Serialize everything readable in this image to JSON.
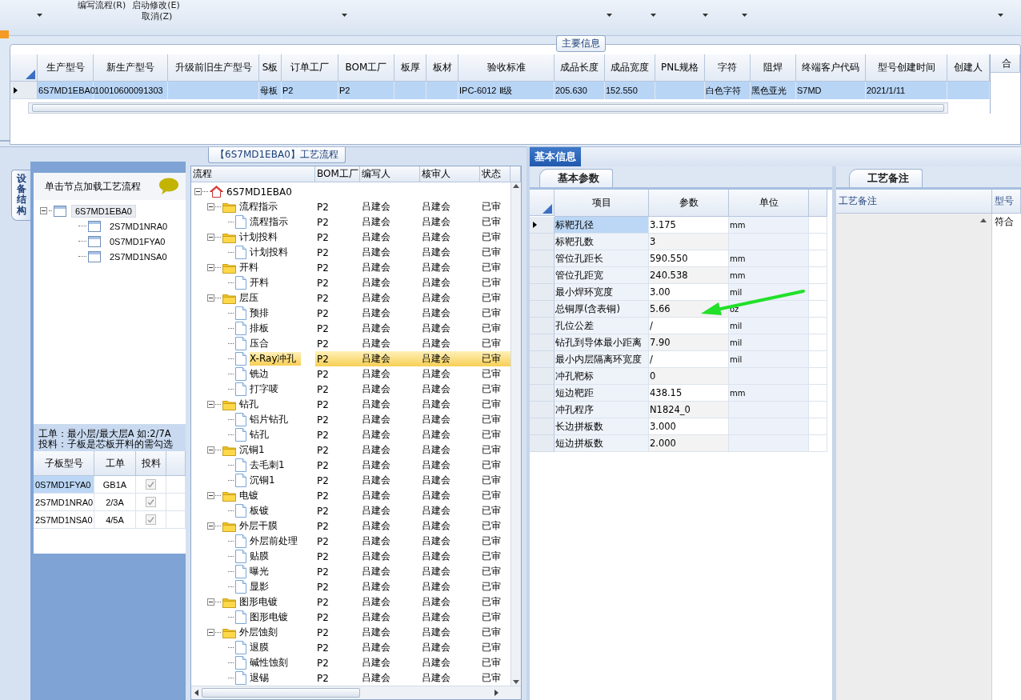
{
  "ribbon": {
    "buttons": [
      {
        "label": "编写流程(R)"
      },
      {
        "label": "启动修改(E)"
      },
      {
        "label": "取消(Z)"
      }
    ]
  },
  "main_info": {
    "title": "主要信息",
    "columns": [
      "生产型号",
      "新生产型号",
      "升级前旧生产型号",
      "S板",
      "订单工厂",
      "BOM工厂",
      "板厚",
      "板材",
      "验收标准",
      "成品长度",
      "成品宽度",
      "PNL规格",
      "字符",
      "阻焊",
      "终端客户代码",
      "型号创建时间",
      "创建人"
    ],
    "rows": [
      {
        "selected": true,
        "cells": [
          "6S7MD1EBA0",
          "10010600091303",
          null,
          "母板",
          "P2",
          "P2",
          null,
          null,
          "IPC-6012 Ⅱ级",
          "205.630",
          "152.550",
          null,
          "白色字符",
          "黑色亚光",
          "S7MD",
          "2021/1/11",
          null
        ]
      }
    ],
    "side_column": "合"
  },
  "structure_tab": {
    "label": "设备结构",
    "selected": true
  },
  "board_tree": {
    "hint": "单击节点加载工艺流程",
    "nodes": [
      {
        "label": "6S7MD1EBA0",
        "selected": true,
        "expanded": true,
        "children": [
          {
            "label": "2S7MD1NRA0",
            "selected": false
          },
          {
            "label": "0S7MD1FYA0",
            "selected": false
          },
          {
            "label": "2S7MD1NSA0",
            "selected": false
          }
        ]
      }
    ]
  },
  "sub_boards": {
    "note_lines": [
      "工单：最小层/最大层A 如:2/7A",
      "投料：子板是芯板开料的需勾选"
    ],
    "columns": [
      "子板型号",
      "工单",
      "投料"
    ],
    "rows": [
      {
        "model": "0S7MD1FYA0",
        "order": "GB1A",
        "feed": true,
        "selected": true
      },
      {
        "model": "2S7MD1NRA0",
        "order": "2/3A",
        "feed": true,
        "selected": false
      },
      {
        "model": "2S7MD1NSA0",
        "order": "4/5A",
        "feed": true,
        "selected": false
      }
    ]
  },
  "process_flow": {
    "title": "【6S7MD1EBA0】工艺流程",
    "columns": [
      "流程",
      "BOM工厂",
      "编写人",
      "核审人",
      "状态"
    ],
    "root": {
      "label": "6S7MD1EBA0",
      "expanded": true,
      "selected": false,
      "children": [
        {
          "label": "流程指示",
          "bom": "P2",
          "writer": "吕建会",
          "reviewer": "吕建会",
          "status": "已审",
          "expanded": true,
          "selected": false,
          "children": [
            {
              "label": "流程指示",
              "bom": "P2",
              "writer": "吕建会",
              "reviewer": "吕建会",
              "status": "已审",
              "selected": false
            }
          ]
        },
        {
          "label": "计划投料",
          "bom": "P2",
          "writer": "吕建会",
          "reviewer": "吕建会",
          "status": "已审",
          "expanded": true,
          "selected": false,
          "children": [
            {
              "label": "计划投料",
              "bom": "P2",
              "writer": "吕建会",
              "reviewer": "吕建会",
              "status": "已审",
              "selected": false
            }
          ]
        },
        {
          "label": "开料",
          "bom": "P2",
          "writer": "吕建会",
          "reviewer": "吕建会",
          "status": "已审",
          "expanded": true,
          "selected": false,
          "children": [
            {
              "label": "开料",
              "bom": "P2",
              "writer": "吕建会",
              "reviewer": "吕建会",
              "status": "已审",
              "selected": false
            }
          ]
        },
        {
          "label": "层压",
          "bom": "P2",
          "writer": "吕建会",
          "reviewer": "吕建会",
          "status": "已审",
          "expanded": true,
          "selected": false,
          "children": [
            {
              "label": "预排",
              "bom": "P2",
              "writer": "吕建会",
              "reviewer": "吕建会",
              "status": "已审",
              "selected": false
            },
            {
              "label": "排板",
              "bom": "P2",
              "writer": "吕建会",
              "reviewer": "吕建会",
              "status": "已审",
              "selected": false
            },
            {
              "label": "压合",
              "bom": "P2",
              "writer": "吕建会",
              "reviewer": "吕建会",
              "status": "已审",
              "selected": false
            },
            {
              "label": "X-Ray冲孔",
              "bom": "P2",
              "writer": "吕建会",
              "reviewer": "吕建会",
              "status": "已审",
              "selected": true
            },
            {
              "label": "铣边",
              "bom": "P2",
              "writer": "吕建会",
              "reviewer": "吕建会",
              "status": "已审",
              "selected": false
            },
            {
              "label": "打字唛",
              "bom": "P2",
              "writer": "吕建会",
              "reviewer": "吕建会",
              "status": "已审",
              "selected": false
            }
          ]
        },
        {
          "label": "钻孔",
          "bom": "P2",
          "writer": "吕建会",
          "reviewer": "吕建会",
          "status": "已审",
          "expanded": true,
          "selected": false,
          "children": [
            {
              "label": "铝片钻孔",
              "bom": "P2",
              "writer": "吕建会",
              "reviewer": "吕建会",
              "status": "已审",
              "selected": false
            },
            {
              "label": "钻孔",
              "bom": "P2",
              "writer": "吕建会",
              "reviewer": "吕建会",
              "status": "已审",
              "selected": false
            }
          ]
        },
        {
          "label": "沉铜1",
          "bom": "P2",
          "writer": "吕建会",
          "reviewer": "吕建会",
          "status": "已审",
          "expanded": true,
          "selected": false,
          "children": [
            {
              "label": "去毛刺1",
              "bom": "P2",
              "writer": "吕建会",
              "reviewer": "吕建会",
              "status": "已审",
              "selected": false
            },
            {
              "label": "沉铜1",
              "bom": "P2",
              "writer": "吕建会",
              "reviewer": "吕建会",
              "status": "已审",
              "selected": false
            }
          ]
        },
        {
          "label": "电镀",
          "bom": "P2",
          "writer": "吕建会",
          "reviewer": "吕建会",
          "status": "已审",
          "expanded": true,
          "selected": false,
          "children": [
            {
              "label": "板镀",
              "bom": "P2",
              "writer": "吕建会",
              "reviewer": "吕建会",
              "status": "已审",
              "selected": false
            }
          ]
        },
        {
          "label": "外层干膜",
          "bom": "P2",
          "writer": "吕建会",
          "reviewer": "吕建会",
          "status": "已审",
          "expanded": true,
          "selected": false,
          "children": [
            {
              "label": "外层前处理",
              "bom": "P2",
              "writer": "吕建会",
              "reviewer": "吕建会",
              "status": "已审",
              "selected": false
            },
            {
              "label": "贴膜",
              "bom": "P2",
              "writer": "吕建会",
              "reviewer": "吕建会",
              "status": "已审",
              "selected": false
            },
            {
              "label": "曝光",
              "bom": "P2",
              "writer": "吕建会",
              "reviewer": "吕建会",
              "status": "已审",
              "selected": false
            },
            {
              "label": "显影",
              "bom": "P2",
              "writer": "吕建会",
              "reviewer": "吕建会",
              "status": "已审",
              "selected": false
            }
          ]
        },
        {
          "label": "图形电镀",
          "bom": "P2",
          "writer": "吕建会",
          "reviewer": "吕建会",
          "status": "已审",
          "expanded": true,
          "selected": false,
          "children": [
            {
              "label": "图形电镀",
              "bom": "P2",
              "writer": "吕建会",
              "reviewer": "吕建会",
              "status": "已审",
              "selected": false
            }
          ]
        },
        {
          "label": "外层蚀刻",
          "bom": "P2",
          "writer": "吕建会",
          "reviewer": "吕建会",
          "status": "已审",
          "expanded": true,
          "selected": false,
          "children": [
            {
              "label": "退膜",
              "bom": "P2",
              "writer": "吕建会",
              "reviewer": "吕建会",
              "status": "已审",
              "selected": false
            },
            {
              "label": "碱性蚀刻",
              "bom": "P2",
              "writer": "吕建会",
              "reviewer": "吕建会",
              "status": "已审",
              "selected": false
            },
            {
              "label": "退锡",
              "bom": "P2",
              "writer": "吕建会",
              "reviewer": "吕建会",
              "status": "已审",
              "selected": false
            }
          ]
        }
      ]
    }
  },
  "info_tab": {
    "label": "基本信息",
    "selected": true
  },
  "params": {
    "tab": {
      "label": "基本参数",
      "selected": true
    },
    "columns": [
      "项目",
      "参数",
      "单位"
    ],
    "rows": [
      {
        "item": "标靶孔径",
        "value": "3.175",
        "unit": "mm",
        "selected": true
      },
      {
        "item": "标靶孔数",
        "value": "3",
        "selected": false
      },
      {
        "item": "管位孔距长",
        "value": "590.550",
        "unit": "mm",
        "selected": false
      },
      {
        "item": "管位孔距宽",
        "value": "240.538",
        "unit": "mm",
        "selected": false
      },
      {
        "item": "最小焊环宽度",
        "value": "3.00",
        "unit": "mil",
        "selected": false
      },
      {
        "item": "总铜厚(含表铜)",
        "value": "5.66",
        "unit": "oz",
        "selected": false
      },
      {
        "item": "孔位公差",
        "value": "/",
        "unit": "mil",
        "selected": false
      },
      {
        "item": "钻孔到导体最小距离",
        "value": "7.90",
        "unit": "mil",
        "selected": false
      },
      {
        "item": "最小内层隔离环宽度",
        "value": "/",
        "unit": "mil",
        "selected": false
      },
      {
        "item": "冲孔靶标",
        "value": "0",
        "selected": false
      },
      {
        "item": "短边靶距",
        "value": "438.15",
        "unit": "mm",
        "selected": false
      },
      {
        "item": "冲孔程序",
        "value": "N1824_0",
        "selected": false
      },
      {
        "item": "长边拼板数",
        "value": "3.000",
        "selected": false
      },
      {
        "item": "短边拼板数",
        "value": "2.000",
        "selected": false
      }
    ]
  },
  "remarks": {
    "tab": {
      "label": "工艺备注",
      "selected": true
    },
    "columns": [
      {
        "header": "工艺备注"
      },
      {
        "header": "型号",
        "value": "符合"
      }
    ]
  }
}
